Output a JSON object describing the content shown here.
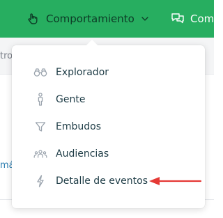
{
  "topbar": {
    "behavior_label": "Comportamiento",
    "comms_label_partial": "Com",
    "accent_color": "#27ae60"
  },
  "background": {
    "subbar_partial_text": "tro",
    "link_partial_text": "má"
  },
  "menu": {
    "items": [
      {
        "label": "Explorador",
        "icon": "binoculars-icon"
      },
      {
        "label": "Gente",
        "icon": "person-icon"
      },
      {
        "label": "Embudos",
        "icon": "funnel-icon"
      },
      {
        "label": "Audiencias",
        "icon": "audience-icon"
      },
      {
        "label": "Detalle de eventos",
        "icon": "lightning-icon"
      }
    ]
  },
  "annotation": {
    "arrow_color": "#e53935"
  }
}
